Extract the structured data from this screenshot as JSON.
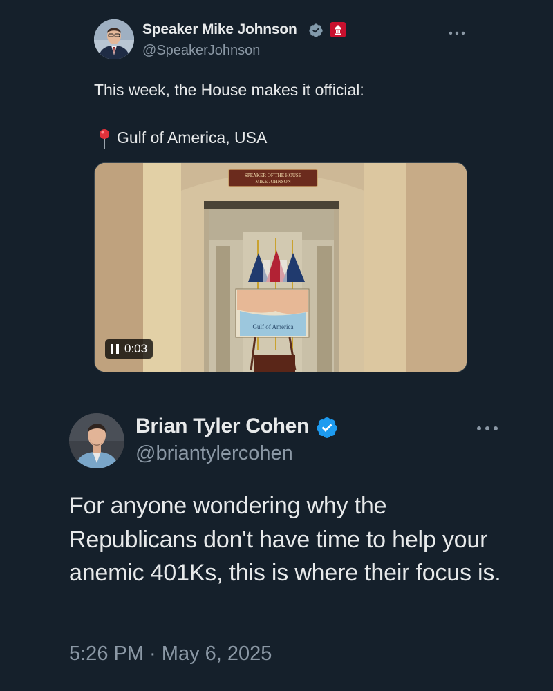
{
  "quoted_tweet": {
    "author_name": "Speaker Mike Johnson",
    "author_handle": "@SpeakerJohnson",
    "verified_badge_icon": "gray-verified-badge-icon",
    "affiliation_icon": "house-seal-icon",
    "text_line1": "This week, the House makes it official:",
    "location_line": "Gulf of America, USA",
    "location_icon": "round-pushpin-icon",
    "media": {
      "type": "video",
      "timestamp": "0:03",
      "sign_text": "SPEAKER OF THE HOUSE MIKE JOHNSON",
      "sign_line1": "SPEAKER OF THE HOUSE",
      "sign_line2": "MIKE JOHNSON",
      "map_label": "Gulf of America"
    }
  },
  "main_tweet": {
    "author_name": "Brian Tyler Cohen",
    "author_handle": "@briantylercohen",
    "verified_badge_icon": "blue-verified-badge-icon",
    "text": "For anyone wondering why the Republicans don't have time to help your anemic 401Ks, this is where their focus is.",
    "time": "5:26 PM",
    "separator": " · ",
    "date": "May 6, 2025"
  },
  "colors": {
    "background": "#15202b",
    "text_primary": "#e7e9ea",
    "text_secondary": "#8b98a5",
    "verified_blue": "#1d9bf0",
    "verified_gray": "#829aab",
    "seal_red": "#c8102e"
  }
}
